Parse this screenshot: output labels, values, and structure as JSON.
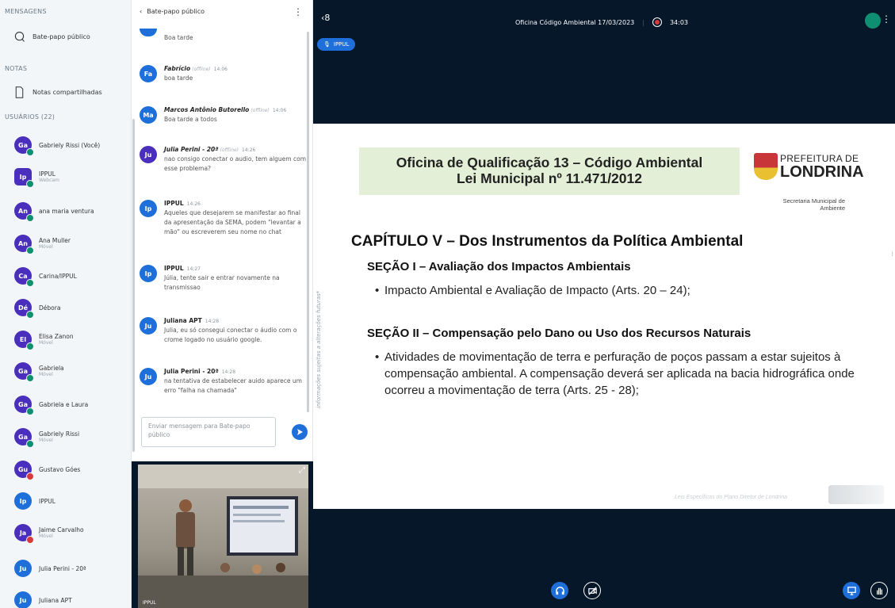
{
  "sidebar": {
    "messages_heading": "MENSAGENS",
    "public_chat_label": "Bate-papo público",
    "notes_heading": "NOTAS",
    "shared_notes_label": "Notas compartilhadas",
    "users_heading": "USUÁRIOS (22)",
    "users": [
      {
        "initials": "Ga",
        "name": "Gabriely Rissi (Você)",
        "sub": "",
        "status": "online"
      },
      {
        "initials": "Ip",
        "name": "IPPUL",
        "sub": "Webcam",
        "status": "online"
      },
      {
        "initials": "An",
        "name": "ana maria ventura",
        "sub": "",
        "status": "online"
      },
      {
        "initials": "An",
        "name": "Ana Muller",
        "sub": "Móvel",
        "status": "online"
      },
      {
        "initials": "Ca",
        "name": "Carina/IPPUL",
        "sub": "",
        "status": "online"
      },
      {
        "initials": "Dé",
        "name": "Débora",
        "sub": "",
        "status": "online"
      },
      {
        "initials": "El",
        "name": "Elisa Zanon",
        "sub": "Móvel",
        "status": "online"
      },
      {
        "initials": "Ga",
        "name": "Gabriela",
        "sub": "Móvel",
        "status": "online"
      },
      {
        "initials": "Ga",
        "name": "Gabriela e Laura",
        "sub": "",
        "status": "online"
      },
      {
        "initials": "Ga",
        "name": "Gabriely Rissi",
        "sub": "Móvel",
        "status": "online"
      },
      {
        "initials": "Gu",
        "name": "Gustavo Góes",
        "sub": "",
        "status": "muted"
      },
      {
        "initials": "Ip",
        "name": "IPPUL",
        "sub": "",
        "status": "none"
      },
      {
        "initials": "Ja",
        "name": "Jaime Carvalho",
        "sub": "Móvel",
        "status": "muted"
      },
      {
        "initials": "Ju",
        "name": "Julia Perini - 20ª",
        "sub": "",
        "status": "none"
      },
      {
        "initials": "Ju",
        "name": "Juliana APT",
        "sub": "",
        "status": "none"
      }
    ]
  },
  "chat": {
    "title": "Bate-papo público",
    "input_placeholder": "Enviar mensagem para Bate-papo público",
    "messages": [
      {
        "initials": "",
        "author": "",
        "offline": "",
        "time": "",
        "text": "Boa tarde"
      },
      {
        "initials": "Fa",
        "author": "Fabrício",
        "offline": "(offline)",
        "time": "14:06",
        "text": "boa tarde"
      },
      {
        "initials": "Ma",
        "author": "Marcos Antônio Butorello",
        "offline": "(offline)",
        "time": "14:06",
        "text": "Boa tarde a todos"
      },
      {
        "initials": "Ju",
        "author": "Julia Perini - 20ª",
        "offline": "(offline)",
        "time": "14:26",
        "text": "nao consigo conectar o audio, tem alguem com esse problema?"
      },
      {
        "initials": "Ip",
        "author": "IPPUL",
        "offline": "",
        "time": "14:26",
        "text": "Aqueles que desejarem se manifestar ao final da apresentação da SEMA, podem \"levantar a mão\" ou escreverem seu nome no chat"
      },
      {
        "initials": "Ip",
        "author": "IPPUL",
        "offline": "",
        "time": "14:27",
        "text": "Júlia, tente sair e entrar novamente na transmissao"
      },
      {
        "initials": "Ju",
        "author": "Juliana APT",
        "offline": "",
        "time": "14:28",
        "text": "Julia, eu só consegui conectar o áudio com o crome logado no usuário google."
      },
      {
        "initials": "Ju",
        "author": "Julia Perini - 20ª",
        "offline": "",
        "time": "14:28",
        "text": "na tentativa de estabelecer auido aparece um erro \"falha na chamada\""
      }
    ]
  },
  "webcam": {
    "label": "IPPUL"
  },
  "topbar": {
    "meeting_title": "Oficina Código Ambiental 17/03/2023",
    "recording_time": "34:03",
    "presenter_tag": "IPPUL"
  },
  "slide": {
    "title_line1": "Oficina de Qualificação 13 – Código Ambiental",
    "title_line2": "Lei Municipal nº 11.471/2012",
    "logo_line1": "PREFEITURA DE",
    "logo_line2": "LONDRINA",
    "logo_sub": "Secretaria Municipal de Ambiente",
    "chapter": "CAPÍTULO V – Dos Instrumentos da Política Ambiental",
    "section1": "SEÇÃO I – Avaliação dos Impactos Ambientais",
    "bullet1": "Impacto Ambiental e Avaliação de Impacto (Arts. 20 – 24);",
    "section2": "SEÇÃO II – Compensação pelo Dano ou Uso dos Recursos Naturais",
    "bullet2": "Atividades de movimentação de terra e perfuração de poços passam a estar sujeitos à compensação ambiental. A compensação deverá ser aplicada na bacia hidrográfica onde ocorreu a movimentação de terra (Arts. 25 - 28);",
    "footer": "Leis Específicas do Plano Diretor de Londrina",
    "side_note": "informações sujeitas a alterações futuras*"
  },
  "colors": {
    "accent": "#1e6fd9",
    "avatar": "#4a2fbd",
    "online": "#0f8f71",
    "muted": "#d63a3a",
    "stage_bg": "#06172a",
    "slide_banner": "#e4efd7"
  }
}
